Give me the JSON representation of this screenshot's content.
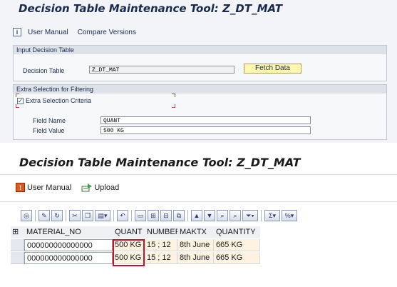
{
  "top": {
    "title": "Decision Table Maintenance Tool: Z_DT_MAT",
    "toolbar": {
      "info_icon": "i",
      "user_manual": "User Manual",
      "compare_versions": "Compare Versions"
    },
    "input_group": {
      "title": "Input Decision Table",
      "decision_table_label": "Decision Table",
      "decision_table_value": "Z_DT_MAT",
      "fetch_button": "Fetch Data"
    },
    "filter_group": {
      "title": "Extra Selection for Filtering",
      "checkbox_label": "Extra Selection Criteria",
      "checkbox_checked": true,
      "field_name_label": "Field Name",
      "field_name_value": "QUANT",
      "field_value_label": "Field Value",
      "field_value_value": "500 KG"
    }
  },
  "bottom": {
    "title": "Decision Table Maintenance Tool: Z_DT_MAT",
    "toolbar": {
      "user_manual": "User Manual",
      "upload": "Upload"
    },
    "grid": {
      "columns": [
        "MATERIAL_NO",
        "QUANT",
        "NUMBER",
        "MAKTX",
        "QUANTITY"
      ],
      "rows": [
        [
          "000000000000000",
          "500 KG",
          "15 ; 12",
          "8th June",
          "665 KG"
        ],
        [
          "000000000000000",
          "500 KG",
          "15 ; 12",
          "8th June",
          "665 KG"
        ]
      ]
    }
  },
  "colors": {
    "highlight": "#c8102e",
    "title_text": "#1a2a50",
    "fetch_button_bg": "#fff6b0"
  },
  "icons": {
    "user_manual": "manual-book-icon",
    "upload": "upload-icon",
    "layout_menu": "layout-menu-icon"
  }
}
